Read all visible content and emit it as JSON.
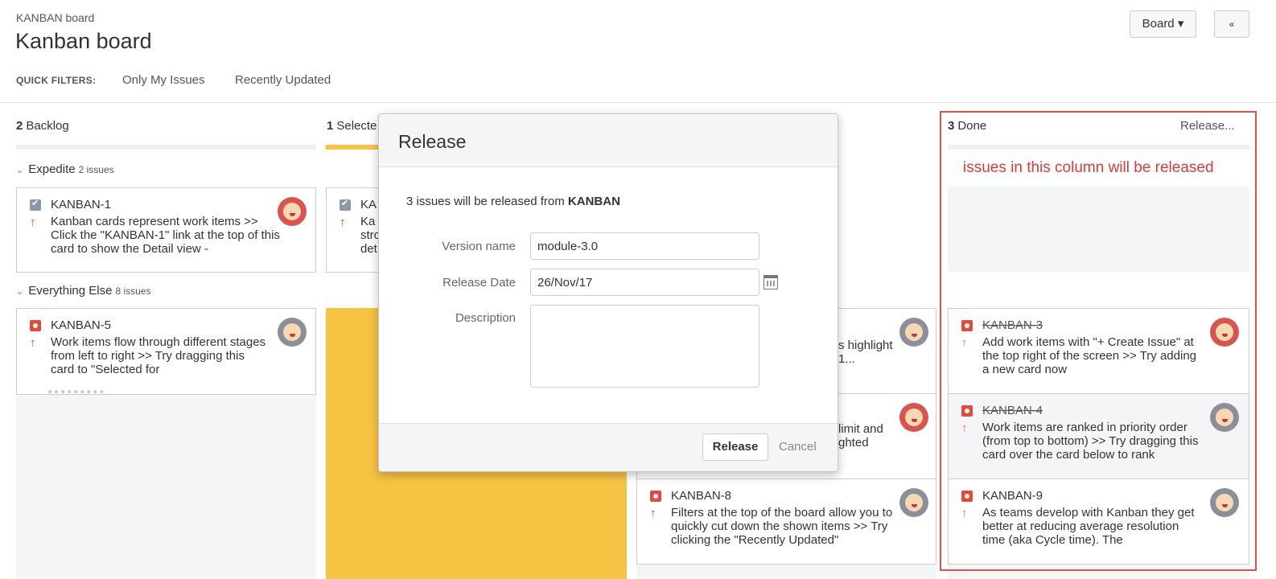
{
  "header": {
    "breadcrumb": "KANBAN board",
    "title": "Kanban board",
    "quick_filters_label": "QUICK FILTERS:",
    "quick_filters": [
      "Only My Issues",
      "Recently Updated"
    ],
    "board_button": "Board ▾",
    "collapse_button": "«"
  },
  "columns": [
    {
      "count": "2",
      "name": "Backlog"
    },
    {
      "count": "1",
      "name": "Selecte"
    },
    {
      "count": "3",
      "name": "Done",
      "action": "Release..."
    }
  ],
  "done_note": "issues in this column will be released",
  "swimlanes": [
    {
      "name": "Expedite",
      "count": "2 issues"
    },
    {
      "name": "Everything Else",
      "count": "8 issues"
    }
  ],
  "cards": {
    "kanban1": {
      "key": "KANBAN-1",
      "summary": "Kanban cards represent work items >> Click the \"KANBAN-1\" link at the top of this card to show the Detail view -"
    },
    "selected_partial": {
      "key": "KA",
      "summary": "Ka stro det"
    },
    "kanban5": {
      "key": "KANBAN-5",
      "summary": "Work items flow through different stages from left to right >> Try dragging this card to \"Selected for"
    },
    "inprog1_partial": {
      "summary": "s highlight 1..."
    },
    "inprog2_partial": {
      "summary": "limit and ghted"
    },
    "kanban8": {
      "key": "KANBAN-8",
      "summary": "Filters at the top of the board allow you to quickly cut down the shown items >> Try clicking the \"Recently Updated\""
    },
    "kanban3": {
      "key": "KANBAN-3",
      "summary": "Add work items with \"+ Create Issue\" at the top right of the screen >> Try adding a new card now"
    },
    "kanban4": {
      "key": "KANBAN-4",
      "summary": "Work items are ranked in priority order (from top to bottom) >> Try dragging this card over the card below to rank"
    },
    "kanban9": {
      "key": "KANBAN-9",
      "summary": "As teams develop with Kanban they get better at reducing average resolution time (aka Cycle time). The"
    }
  },
  "modal": {
    "title": "Release",
    "info_prefix": "3 issues will be released from ",
    "info_project": "KANBAN",
    "version_label": "Version name",
    "version_value": "module-3.0",
    "date_label": "Release Date",
    "date_value": "26/Nov/17",
    "description_label": "Description",
    "description_value": "",
    "release_button": "Release",
    "cancel_link": "Cancel"
  },
  "colors": {
    "done_highlight": "#d9534f",
    "selected_column": "#f6c342",
    "bug": "#e5493a",
    "task": "#8c97a8",
    "priority_high": "#d04437",
    "priority_medium": "#ea7d24"
  },
  "icons": [
    "task-icon",
    "bug-icon",
    "priority-arrow-icon",
    "calendar-icon",
    "chevron-down-icon",
    "avatar"
  ]
}
